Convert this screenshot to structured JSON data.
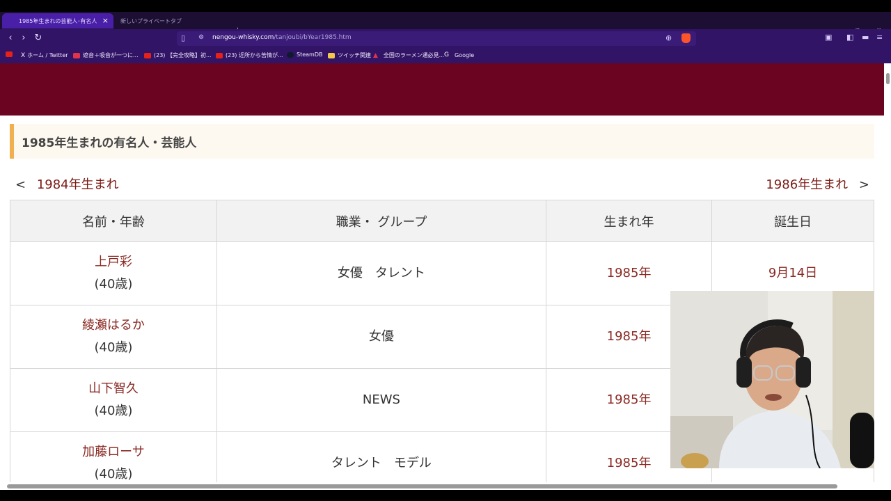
{
  "browser": {
    "tabs": [
      {
        "label": "1985年生まれの芸能人･有名人の…",
        "active": true
      },
      {
        "label": "新しいプライベートタブ",
        "active": false
      }
    ],
    "new_tab": "+",
    "window_controls": {
      "minimize": "–",
      "maximize": "⧉",
      "close": "✕"
    },
    "url_host": "nengou-whisky.com",
    "url_path": "/tanjoubi/bYear1985.htm",
    "bookmarks": [
      {
        "label": "",
        "icon": "youtube-icon"
      },
      {
        "label": "ホーム / Twitter",
        "icon": "x-icon"
      },
      {
        "label": "遮音＋吸音が一つに...",
        "icon": "red-icon"
      },
      {
        "label": "(23) 【完全攻略】初...",
        "icon": "youtube-icon"
      },
      {
        "label": "(23) 近所から苦情が...",
        "icon": "youtube-icon"
      },
      {
        "label": "SteamDB",
        "icon": "steam-icon"
      },
      {
        "label": "ツイッチ関連",
        "icon": "folder-icon"
      },
      {
        "label": "全国のラーメン通必見...",
        "icon": "ramen-icon"
      },
      {
        "label": "Google",
        "icon": "google-icon"
      }
    ]
  },
  "page": {
    "heading": "1985年生まれの有名人・芸能人",
    "prev": {
      "arrow": "<",
      "label": "1984年生まれ"
    },
    "next": {
      "arrow": ">",
      "label": "1986年生まれ"
    },
    "table": {
      "headers": [
        "名前・年齢",
        "職業・ グループ",
        "生まれ年",
        "誕生日"
      ],
      "rows": [
        {
          "name": "上戸彩",
          "age": "(40歳)",
          "job": "女優　タレント",
          "year": "1985年",
          "birthday": "9月14日"
        },
        {
          "name": "綾瀬はるか",
          "age": "(40歳)",
          "job": "女優",
          "year": "1985年",
          "birthday": ""
        },
        {
          "name": "山下智久",
          "age": "(40歳)",
          "job": "NEWS",
          "year": "1985年",
          "birthday": ""
        },
        {
          "name": "加藤ローサ",
          "age": "(40歳)",
          "job": "タレント　モデル",
          "year": "1985年",
          "birthday": ""
        }
      ]
    }
  },
  "colors": {
    "banner": "#6a0420",
    "link": "#8a2a24",
    "accent": "#f0b050",
    "tab_active": "#4a1fa8"
  }
}
